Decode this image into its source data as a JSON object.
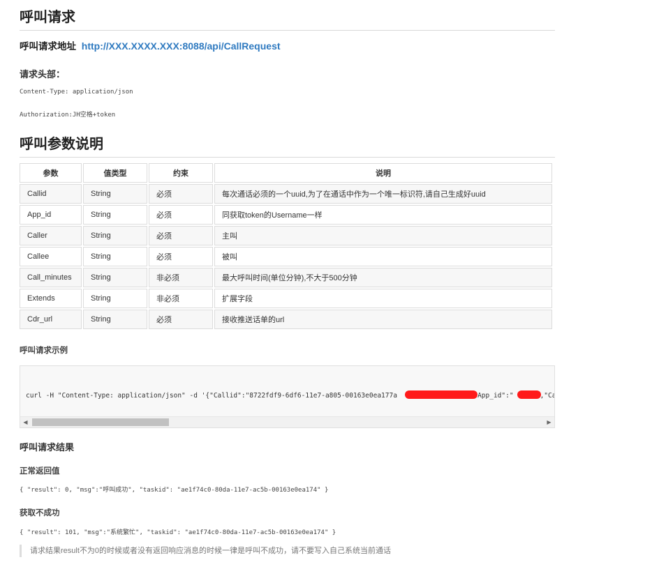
{
  "title": "呼叫请求",
  "address": {
    "label": "呼叫请求地址",
    "url": "http://XXX.XXXX.XXX:8088/api/CallRequest"
  },
  "headers": {
    "title": "请求头部：",
    "lines": [
      "Content-Type: application/json",
      "Authorization:JH空格+token"
    ]
  },
  "params_title": "呼叫参数说明",
  "table": {
    "headers": [
      "参数",
      "值类型",
      "约束",
      "说明"
    ],
    "rows": [
      [
        "Callid",
        "String",
        "必须",
        "每次通话必须的一个uuid,为了在通话中作为一个唯一标识符,请自己生成好uuid"
      ],
      [
        "App_id",
        "String",
        "必须",
        "同获取token的Username一样"
      ],
      [
        "Caller",
        "String",
        "必须",
        "主叫"
      ],
      [
        "Callee",
        "String",
        "必须",
        "被叫"
      ],
      [
        "Call_minutes",
        "String",
        "非必须",
        "最大呼叫时间(单位分钟),不大于500分钟"
      ],
      [
        "Extends",
        "String",
        "非必须",
        "扩展字段"
      ],
      [
        "Cdr_url",
        "String",
        "必须",
        "接收推送话单的url"
      ]
    ]
  },
  "example": {
    "title": "呼叫请求示例",
    "code_start": "curl -H \"Content-Type: application/json\" -d '{\"Callid\":\"8722fdf9-6df6-11e7-a805-00163e0ea177a",
    "code_mid": "\",\"App_id\":\"",
    "code_end": ",\"Cal"
  },
  "result": {
    "title": "呼叫请求结果",
    "success_label": "正常返回值",
    "success_code": "{ \"result\": 0, \"msg\":\"呼叫成功\", \"taskid\": \"ae1f74c0-80da-11e7-ac5b-00163e0ea174\" }",
    "fail_label": "获取不成功",
    "fail_code": "{ \"result\": 101, \"msg\":\"系统繁忙\", \"taskid\": \"ae1f74c0-80da-11e7-ac5b-00163e0ea174\" }",
    "note": "请求结果result不为0的时候或者没有返回响应消息的时候一律是呼叫不成功，请不要写入自己系统当前通话"
  },
  "colors": {
    "link": "#2f7ac0",
    "redaction": "#ff1a1a",
    "border": "#dcdcdc"
  }
}
